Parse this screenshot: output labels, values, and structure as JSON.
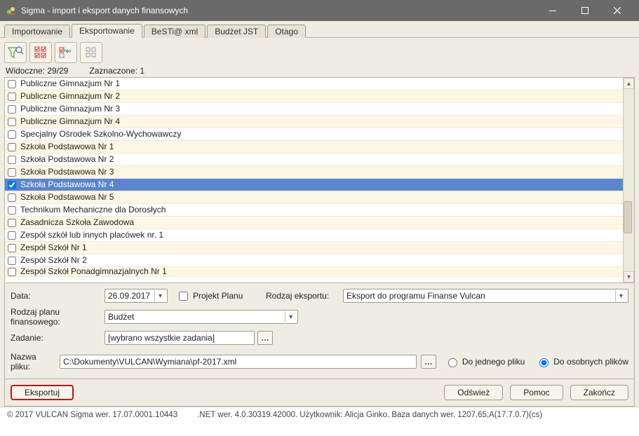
{
  "window": {
    "title": "Sigma - import i eksport danych finansowych"
  },
  "tabs": {
    "t0": "Importowanie",
    "t1": "Eksportowanie",
    "t2": "BeSTi@ xml",
    "t3": "Budżet JST",
    "t4": "Otago"
  },
  "status": {
    "visible": "Widoczne:  29/29",
    "selected": "Zaznaczone:  1"
  },
  "list": [
    "Publiczne Gimnazjum Nr 1",
    "Publiczne Gimnazjum Nr 2",
    "Publiczne Gimnazjum Nr 3",
    "Publiczne Gimnazjum Nr 4",
    "Specjalny Ośrodek Szkolno-Wychowawczy",
    "Szkoła Podstawowa Nr 1",
    "Szkoła Podstawowa Nr 2",
    "Szkoła Podstawowa Nr 3",
    "Szkoła Podstawowa Nr 4",
    "Szkoła Podstawowa Nr 5",
    "Technikum Mechaniczne dla Dorosłych",
    "Zasadnicza Szkoła Zawodowa",
    "Zespół szkół lub innych placówek nr. 1",
    "Zespół Szkół Nr 1",
    "Zespół Szkół Nr 2",
    "Zespół Szkół Ponadgimnazjalnych Nr 1"
  ],
  "form": {
    "date_label": "Data:",
    "date_value": "26.09.2017",
    "project_plan": "Projekt Planu",
    "export_kind_label": "Rodzaj eksportu:",
    "export_kind_value": "Eksport do programu Finanse Vulcan",
    "plan_kind_label": "Rodzaj planu finansowego:",
    "plan_kind_value": "Budżet",
    "task_label": "Zadanie:",
    "task_value": "[wybrano wszystkie zadania]",
    "file_name_label": "Nazwa pliku:",
    "file_name_value": "C:\\Dokumenty\\VULCAN\\Wymiana\\pf-2017.xml",
    "radio_single": "Do jednego pliku",
    "radio_multi": "Do osobnych plików"
  },
  "buttons": {
    "export": "Eksportuj",
    "refresh": "Odśwież",
    "help": "Pomoc",
    "close": "Zakończ"
  },
  "footer": {
    "left": "© 2017 VULCAN Sigma wer. 17.07.0001.10443",
    "right": ".NET wer. 4.0.30319.42000. Użytkownik: Alicja Ginko. Baza danych wer. 1207.65;A(17.7.0.7)(cs)"
  }
}
